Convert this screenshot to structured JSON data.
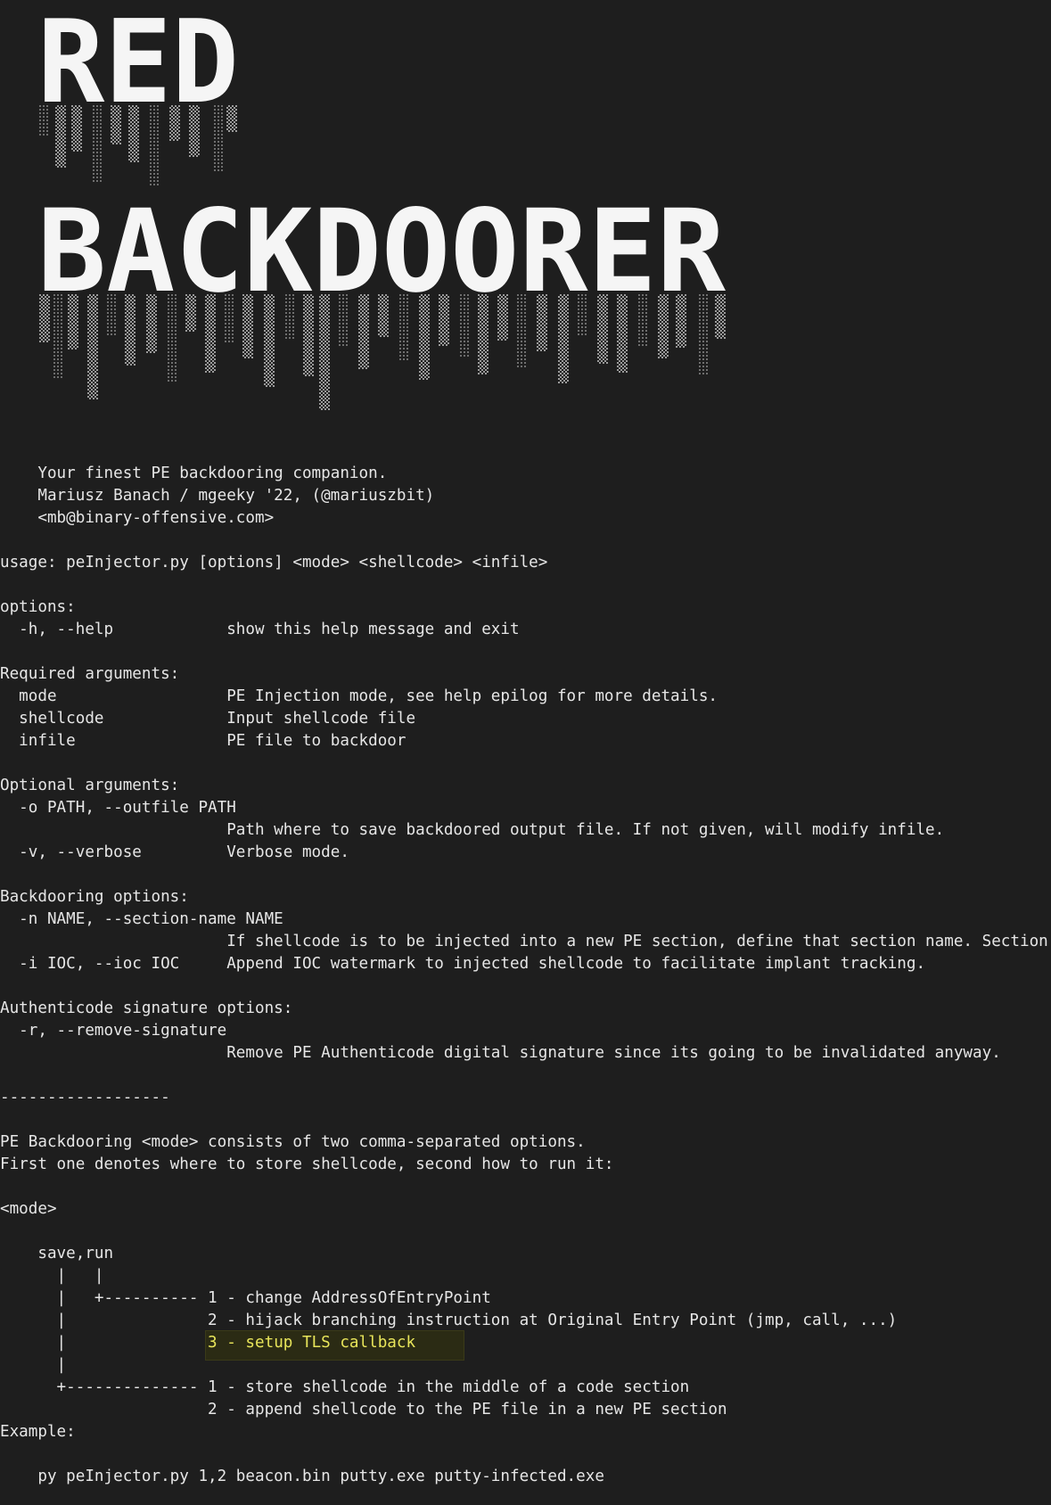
{
  "banner": {
    "word1": "RED",
    "word2": "BACKDOORER"
  },
  "header": {
    "tagline": "    Your finest PE backdooring companion.",
    "author": "    Mariusz Banach / mgeeky '22, (@mariuszbit)",
    "email": "    <mb@binary-offensive.com>"
  },
  "usage": "usage: peInjector.py [options] <mode> <shellcode> <infile>",
  "options": {
    "heading": "options:",
    "help": "  -h, --help            show this help message and exit"
  },
  "required": {
    "heading": "Required arguments:",
    "mode": "  mode                  PE Injection mode, see help epilog for more details.",
    "shellcode": "  shellcode             Input shellcode file",
    "infile": "  infile                PE file to backdoor"
  },
  "optional": {
    "heading": "Optional arguments:",
    "outfile": "  -o PATH, --outfile PATH",
    "outfile_desc": "                        Path where to save backdoored output file. If not given, will modify infile.",
    "verbose": "  -v, --verbose         Verbose mode."
  },
  "backdooring": {
    "heading": "Backdooring options:",
    "section": "  -n NAME, --section-name NAME",
    "section_desc": "                        If shellcode is to be injected into a new PE section, define that section name. Section",
    "ioc": "  -i IOC, --ioc IOC     Append IOC watermark to injected shellcode to facilitate implant tracking."
  },
  "authenticode": {
    "heading": "Authenticode signature options:",
    "remove": "  -r, --remove-signature",
    "remove_desc": "                        Remove PE Authenticode digital signature since its going to be invalidated anyway."
  },
  "separator": "------------------",
  "epilog": {
    "line1": "PE Backdooring <mode> consists of two comma-separated options.",
    "line2": "First one denotes where to store shellcode, second how to run it:",
    "mode_tag": "<mode>",
    "save_run": "    save,run",
    "tree1": "      |   |",
    "run1": "      |   +---------- 1 - change AddressOfEntryPoint",
    "run2": "      |               2 - hijack branching instruction at Original Entry Point (jmp, call, ...)",
    "run3_prefix": "      |               ",
    "run3": "3 - setup TLS callback",
    "tree2": "      |",
    "save1": "      +-------------- 1 - store shellcode in the middle of a code section",
    "save2": "                      2 - append shellcode to the PE file in a new PE section",
    "example_heading": "Example:",
    "example": "    py peInjector.py 1,2 beacon.bin putty.exe putty-infected.exe"
  }
}
